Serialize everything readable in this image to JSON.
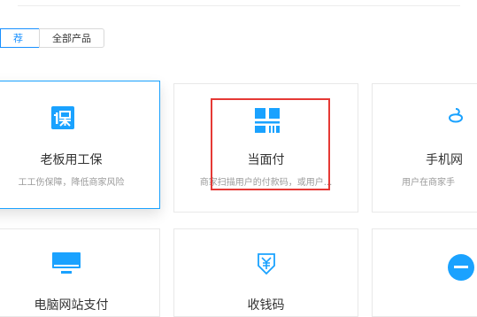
{
  "tabs": [
    {
      "label": "荐",
      "active": true
    },
    {
      "label": "全部产品",
      "active": false
    }
  ],
  "products": [
    {
      "title": "老板用工保",
      "desc": "工工伤保障，降低商家风险",
      "icon": "shield-document-icon",
      "selected": true
    },
    {
      "title": "当面付",
      "desc": "商家扫描用户的付款码，或用户...",
      "icon": "qr-barcode-icon"
    },
    {
      "title": "手机网",
      "desc": "用户在商家手",
      "icon": "phone-payment-icon"
    },
    {
      "title": "电脑网站支付",
      "desc": "",
      "icon": "monitor-icon"
    },
    {
      "title": "收钱码",
      "desc": "",
      "icon": "yen-receipt-icon"
    },
    {
      "title": "",
      "desc": "",
      "icon": "add-circle-icon"
    }
  ],
  "colors": {
    "accent": "#1aa2ff",
    "highlight": "#e53935",
    "border": "#e8e8e8"
  }
}
